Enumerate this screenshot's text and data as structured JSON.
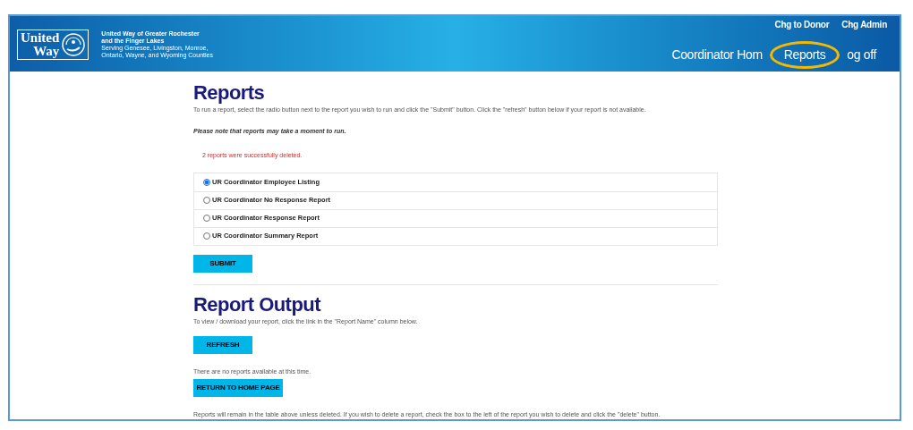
{
  "header": {
    "org_name": "United Way of Greater Rochester",
    "org_name_2": "and the Finger Lakes",
    "serving": "Serving Genesee, Livingston, Monroe,",
    "serving_2": "Ontario, Wayne, and Wyoming Counties",
    "logo_text": "United",
    "logo_text_2": "Way",
    "top_links": [
      "Chg to Donor",
      "Chg Admin"
    ],
    "nav": [
      {
        "label": "Coordinator Hom",
        "highlighted": false
      },
      {
        "label": "Reports",
        "highlighted": true
      },
      {
        "label": "og off",
        "highlighted": false
      }
    ]
  },
  "reports": {
    "title": "Reports",
    "intro": "To run a report, select the radio button next to the report you wish to run and click the \"Submit\" button. Click the \"refresh\" button below if your report is not available.",
    "note": "Please note that reports may take a moment to run.",
    "message": "2 reports were successfully deleted.",
    "options": [
      {
        "label": "UR Coordinator Employee Listing",
        "selected": true
      },
      {
        "label": "UR Coordinator No Response Report",
        "selected": false
      },
      {
        "label": "UR Coordinator Response Report",
        "selected": false
      },
      {
        "label": "UR Coordinator Summary Report",
        "selected": false
      }
    ],
    "submit": "SUBMIT"
  },
  "output": {
    "title": "Report Output",
    "intro": "To view / download your report, click the link in the \"Report Name\" column below.",
    "refresh": "REFRESH",
    "empty": "There are no reports available at this time.",
    "home": "RETURN TO HOME PAGE",
    "footer": "Reports will remain in the table above unless deleted. If you wish to delete a report, check the box to the left of the report you wish to delete and click the \"delete\" button."
  }
}
